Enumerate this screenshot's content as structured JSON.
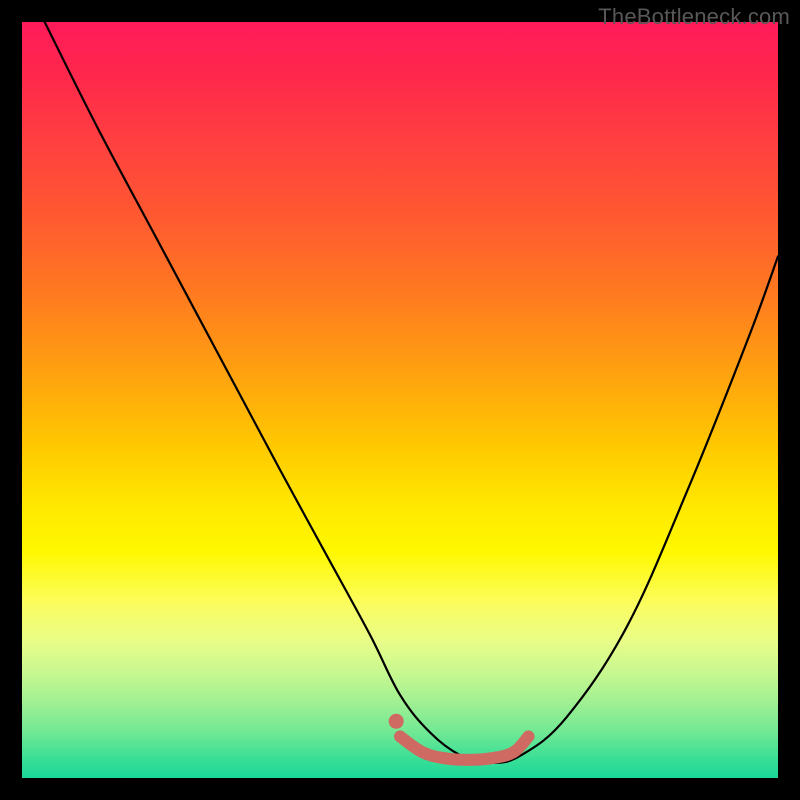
{
  "watermark": "TheBottleneck.com",
  "chart_data": {
    "type": "line",
    "title": "",
    "xlabel": "",
    "ylabel": "",
    "xlim": [
      0,
      100
    ],
    "ylim": [
      0,
      100
    ],
    "series": [
      {
        "name": "black-v-curve",
        "x": [
          3,
          10,
          18,
          26,
          34,
          40,
          46,
          50,
          54,
          58,
          62,
          66,
          72,
          80,
          88,
          96,
          100
        ],
        "y": [
          100,
          86,
          71,
          56,
          41,
          30,
          19,
          11,
          6,
          3,
          2,
          3,
          8,
          20,
          38,
          58,
          69
        ]
      },
      {
        "name": "highlight-trough",
        "x": [
          50,
          53,
          56,
          59,
          62,
          65,
          67
        ],
        "y": [
          5.5,
          3.4,
          2.6,
          2.4,
          2.6,
          3.4,
          5.5
        ]
      }
    ],
    "annotations": [
      {
        "name": "highlight-dot",
        "x": 49.5,
        "y": 7.5
      }
    ],
    "background": {
      "type": "vertical-gradient",
      "stops": [
        {
          "pos": 0.0,
          "color": "#ff1a5a"
        },
        {
          "pos": 0.5,
          "color": "#ffc800"
        },
        {
          "pos": 0.7,
          "color": "#fff800"
        },
        {
          "pos": 1.0,
          "color": "#18d898"
        }
      ]
    }
  }
}
